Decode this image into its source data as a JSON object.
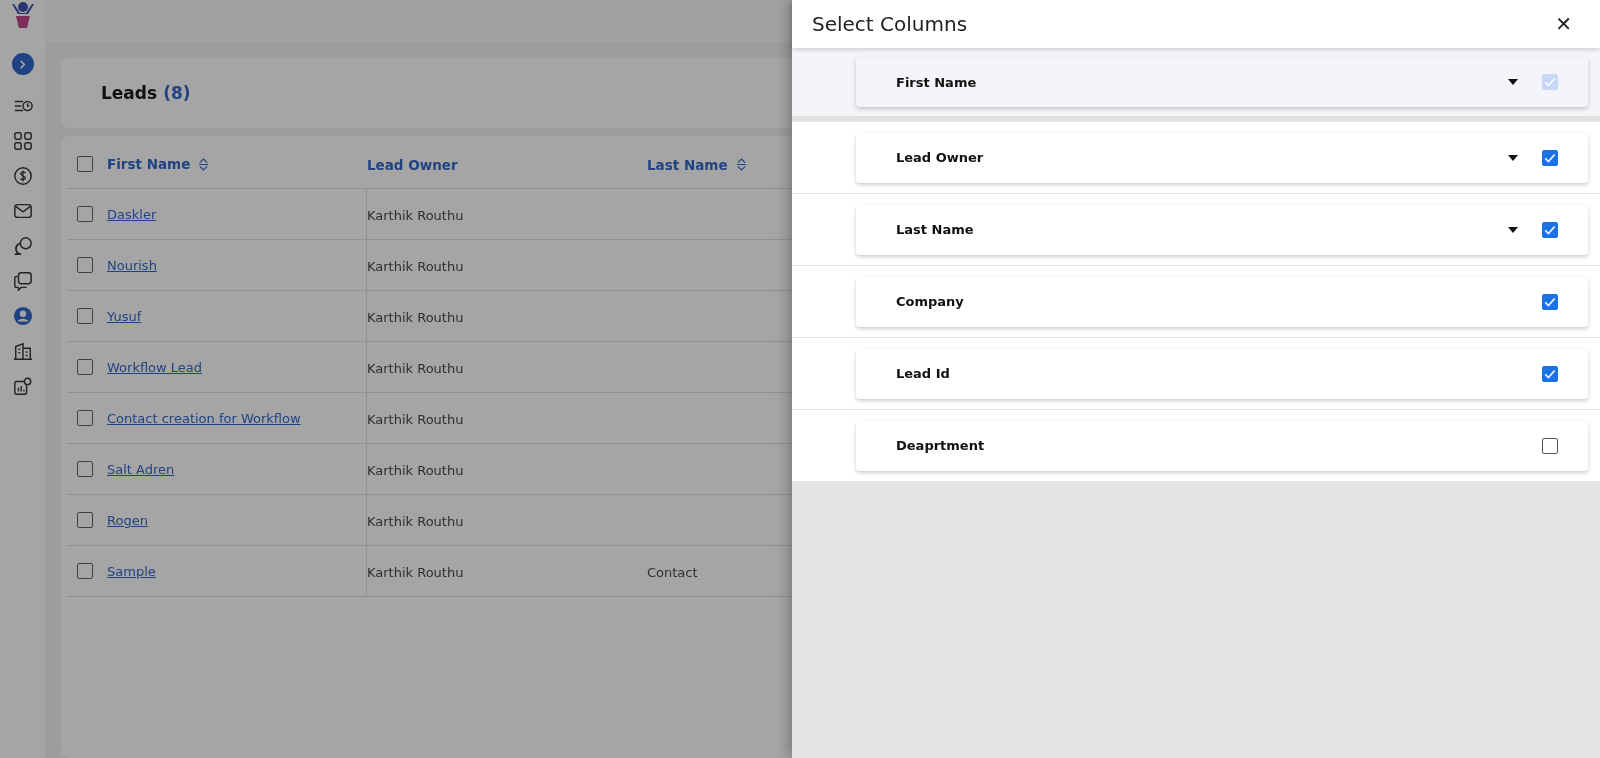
{
  "sidebar": {
    "items": [
      {
        "selected": false
      },
      {
        "selected": false
      },
      {
        "selected": false
      },
      {
        "selected": false
      },
      {
        "selected": false
      },
      {
        "selected": false
      },
      {
        "selected": true
      },
      {
        "selected": false
      },
      {
        "selected": false
      }
    ]
  },
  "leads": {
    "title": "Leads",
    "count": "(8)"
  },
  "table": {
    "select_all": {
      "checked": false
    },
    "columns": [
      {
        "label": "First Name",
        "sortable": true
      },
      {
        "label": "Lead Owner",
        "sortable": false
      },
      {
        "label": "Last Name",
        "sortable": true
      }
    ],
    "rows": [
      {
        "checked": false,
        "first_name": "Daskler",
        "lead_owner": "Karthik Routhu"
      },
      {
        "checked": false,
        "first_name": "Nourish",
        "lead_owner": "Karthik Routhu"
      },
      {
        "checked": false,
        "first_name": "Yusuf",
        "lead_owner": "Karthik Routhu"
      },
      {
        "checked": false,
        "first_name": "Workflow Lead",
        "lead_owner": "Karthik Routhu"
      },
      {
        "checked": false,
        "first_name": "Contact creation for Workflow",
        "lead_owner": "Karthik Routhu"
      },
      {
        "checked": false,
        "first_name": "Salt Adren",
        "lead_owner": "Karthik Routhu"
      },
      {
        "checked": false,
        "first_name": "Rogen",
        "lead_owner": "Karthik Routhu"
      },
      {
        "checked": false,
        "first_name": "Sample",
        "lead_owner": "Karthik Routhu",
        "last_name": "Contact"
      }
    ]
  },
  "drawer": {
    "title": "Select Columns",
    "close": "✕",
    "columns": [
      {
        "label": "First Name",
        "has_menu": true,
        "checked": true,
        "disabled": true
      },
      {
        "label": "Lead Owner",
        "has_menu": true,
        "checked": true,
        "disabled": false
      },
      {
        "label": "Last Name",
        "has_menu": true,
        "checked": true,
        "disabled": false
      },
      {
        "label": "Company",
        "has_menu": false,
        "checked": true,
        "disabled": false
      },
      {
        "label": "Lead Id",
        "has_menu": false,
        "checked": true,
        "disabled": false
      },
      {
        "label": "Deaprtment",
        "has_menu": false,
        "checked": false,
        "disabled": false
      }
    ]
  }
}
